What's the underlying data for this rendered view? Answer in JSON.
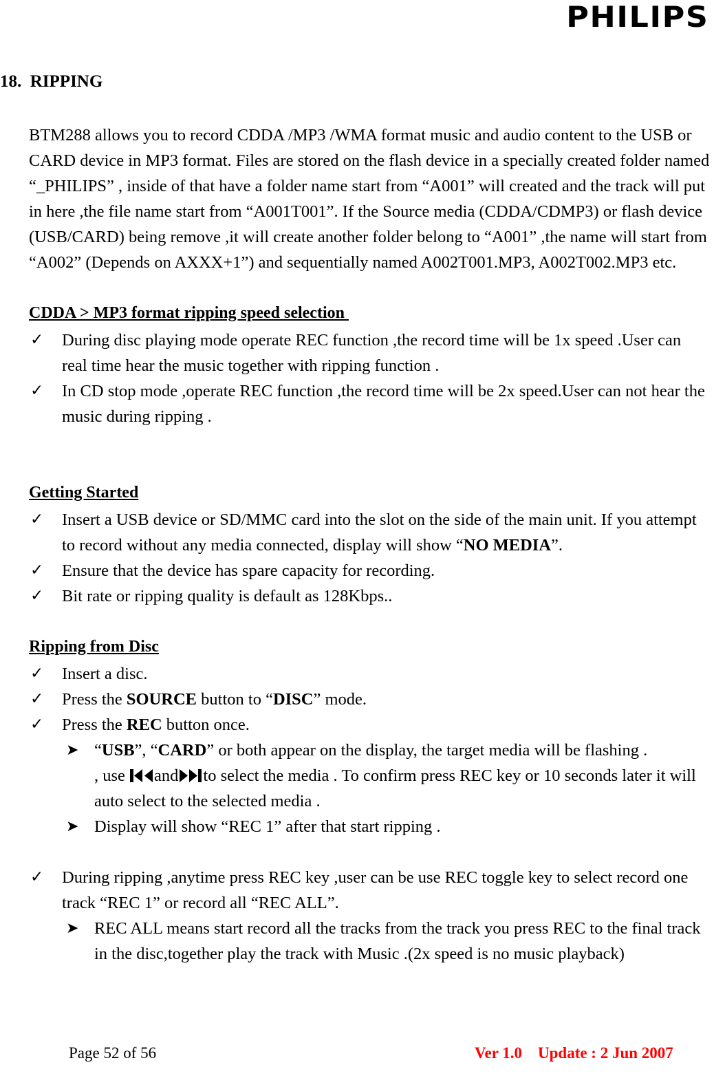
{
  "header": {
    "brand_logo_text": "PHILIPS"
  },
  "section": {
    "number_and_title": "18.  RIPPING"
  },
  "intro": {
    "paragraph": "BTM288 allows you to record CDDA /MP3 /WMA format music and audio content to the USB or CARD device in MP3 format.    Files are stored on the flash device in a specially created folder named “_PHILIPS” , inside of that have a folder name start from “A001” will created and the track will put in here ,the file name start from “A001T001”. If the Source media (CDDA/CDMP3) or flash device (USB/CARD) being remove ,it will create another folder belong to “A001” ,the name will start from “A002” (Depends on AXXX+1”) and sequentially named A002T001.MP3, A002T002.MP3 etc."
  },
  "speed_section": {
    "heading": "CDDA > MP3 format ripping speed selection ",
    "bullet_marker": "✓",
    "items": [
      "During disc playing mode operate REC function ,the record time will be 1x speed .User can real time hear the music together with ripping function .",
      "In CD stop mode ,operate REC function ,the record time will be 2x speed.User can not hear the music during ripping ."
    ]
  },
  "getting_started": {
    "heading": "Getting Started",
    "bullet_marker": "✓",
    "items": [
      {
        "prefix": "Insert a USB device or SD/MMC card into the slot on the side of the main unit.    If you attempt to record without any media connected, display will show “",
        "bold": "NO MEDIA",
        "suffix": "”."
      },
      {
        "prefix": "Ensure that the device has spare capacity for recording.",
        "bold": "",
        "suffix": ""
      },
      {
        "prefix": "Bit rate or ripping quality is default as 128Kbps..",
        "bold": "",
        "suffix": ""
      }
    ]
  },
  "ripping_from_disc": {
    "heading": "Ripping from Disc",
    "bullet_marker": "✓",
    "sub_bullet_marker": "➤",
    "item_insert_disc": "Insert a disc.",
    "item_source": {
      "prefix": "Press the ",
      "bold1": "SOURCE",
      "middle": " button to “",
      "bold2": "DISC",
      "suffix": "” mode."
    },
    "item_rec": {
      "prefix": "Press the ",
      "bold1": "REC",
      "suffix": " button once."
    },
    "sub_usb_card": {
      "quote_open": "“",
      "bold1": "USB",
      "mid1": "”, “",
      "bold2": "CARD",
      "tail": "” or both appear on the display, the target media will be flashing ."
    },
    "sub_use_keys": {
      "before_icons": ", use  ",
      "prev_icon": "previous-track-icon",
      "between_icons": "and",
      "next_icon": "next-track-icon",
      "after_icons": "to select the media . To confirm press REC key or 10 seconds later it will auto select to the selected media ."
    },
    "sub_display": "Display will show “REC 1” after that start ripping ."
  },
  "during_ripping": {
    "bullet_marker": "✓",
    "sub_bullet_marker": "➤",
    "item": "During ripping ,anytime press REC key ,user can be use REC toggle key to select record one track “REC 1” or record all “REC ALL”.",
    "sub_item": "REC ALL means start record all the tracks from the track you press REC to the final track in the disc,together play the track with Music .(2x speed is no music playback)"
  },
  "footer": {
    "page_label": "Page 52 of 56",
    "version_label": "Ver 1.0    Update : 2 Jun 2007",
    "version_color": "#ff0000"
  }
}
